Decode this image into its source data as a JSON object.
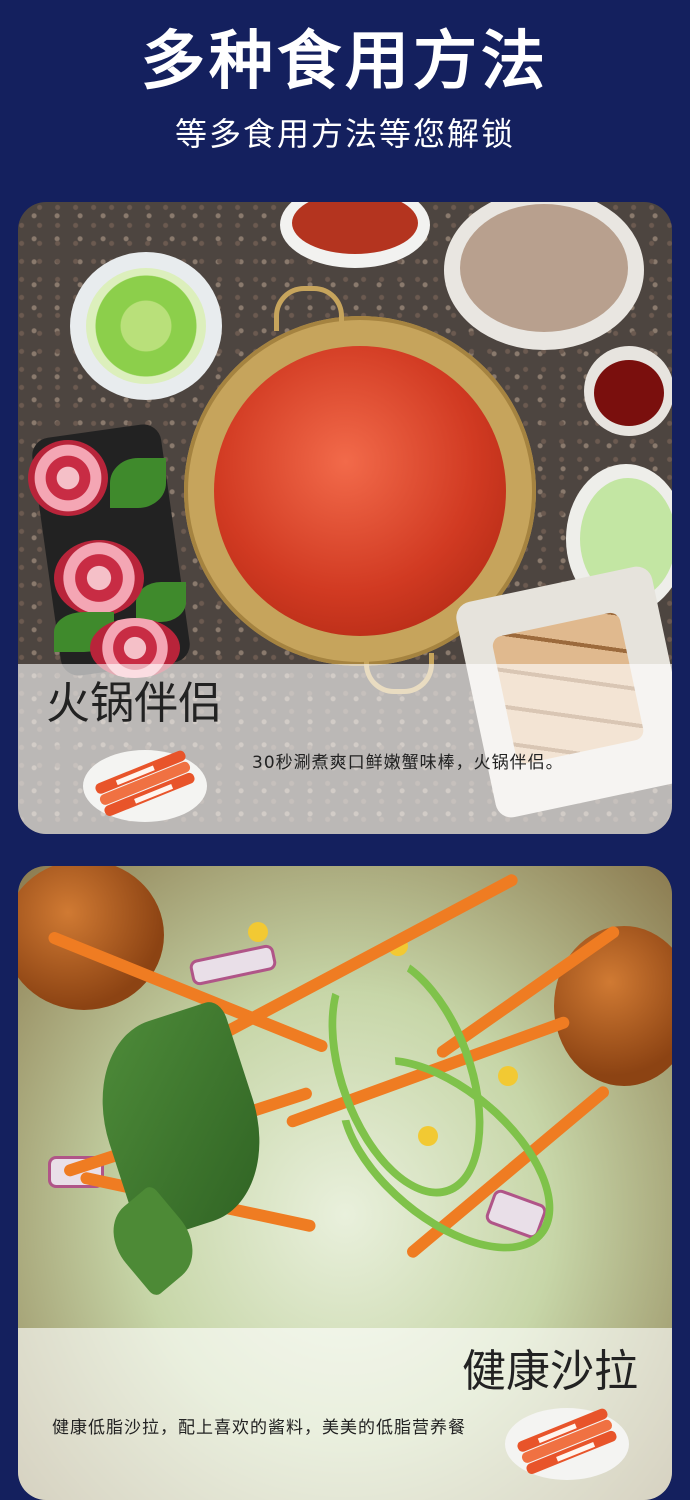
{
  "header": {
    "title": "多种食用方法",
    "subtitle": "等多食用方法等您解锁"
  },
  "sections": [
    {
      "label": "火锅伴侣",
      "description": "30秒涮煮爽口鲜嫩蟹味棒，火锅伴侣。"
    },
    {
      "label": "健康沙拉",
      "description": "健康低脂沙拉，配上喜欢的酱料，美美的低脂营养餐"
    }
  ],
  "colors": {
    "background": "#14205e",
    "title_text": "#ffffff",
    "panel_overlay": "rgba(255,255,255,0.62)",
    "crab_stick": "#e8542a"
  }
}
